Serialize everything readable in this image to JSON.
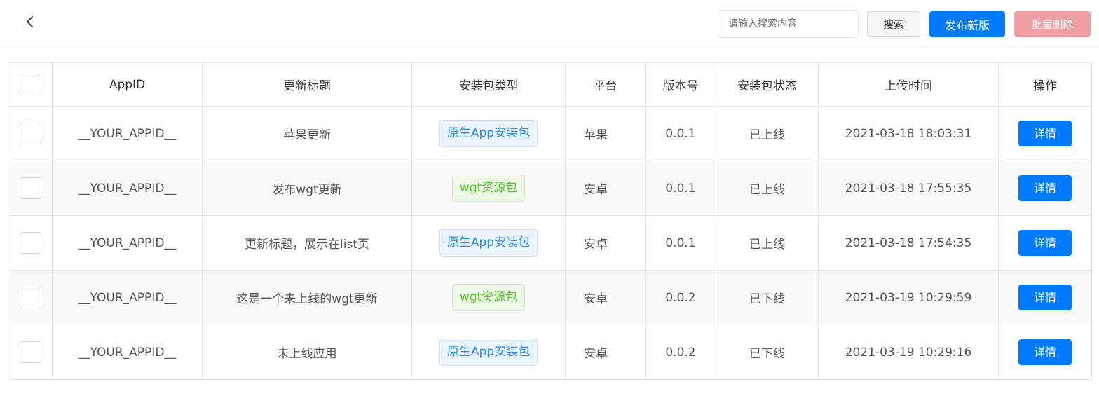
{
  "header": {
    "back_icon": "chevron-left-icon",
    "search_placeholder": "请输入搜索内容",
    "search_value": "",
    "search_label": "搜索",
    "publish_label": "发布新版",
    "delete_label": "批量删除"
  },
  "table": {
    "columns": [
      "AppID",
      "更新标题",
      "安装包类型",
      "平台",
      "版本号",
      "安装包状态",
      "上传时间",
      "操作"
    ],
    "rows": [
      {
        "appid": "__YOUR_APPID__",
        "title": "苹果更新",
        "type": "原生App安装包",
        "type_style": "blue",
        "platform": "苹果",
        "version": "0.0.1",
        "status": "已上线",
        "time": "2021-03-18 18:03:31",
        "action": "详情"
      },
      {
        "appid": "__YOUR_APPID__",
        "title": "发布wgt更新",
        "type": "wgt资源包",
        "type_style": "green",
        "platform": "安卓",
        "version": "0.0.1",
        "status": "已上线",
        "time": "2021-03-18 17:55:35",
        "action": "详情"
      },
      {
        "appid": "__YOUR_APPID__",
        "title": "更新标题，展示在list页",
        "type": "原生App安装包",
        "type_style": "blue",
        "platform": "安卓",
        "version": "0.0.1",
        "status": "已上线",
        "time": "2021-03-18 17:54:35",
        "action": "详情"
      },
      {
        "appid": "__YOUR_APPID__",
        "title": "这是一个未上线的wgt更新",
        "type": "wgt资源包",
        "type_style": "green",
        "platform": "安卓",
        "version": "0.0.2",
        "status": "已下线",
        "time": "2021-03-19 10:29:59",
        "action": "详情"
      },
      {
        "appid": "__YOUR_APPID__",
        "title": "未上线应用",
        "type": "原生App安装包",
        "type_style": "blue",
        "platform": "安卓",
        "version": "0.0.2",
        "status": "已下线",
        "time": "2021-03-19 10:29:16",
        "action": "详情"
      }
    ]
  },
  "colors": {
    "primary": "#007aff",
    "danger_disabled": "#f09aa0",
    "tag_blue": "#2d8cf0",
    "tag_green": "#5cbf2e"
  }
}
